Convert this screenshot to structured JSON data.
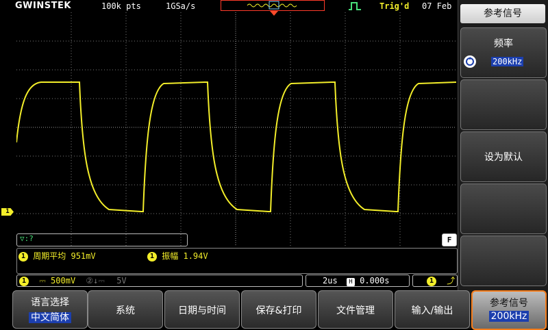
{
  "top_bar": {
    "brand": "GWINSTEK",
    "record_length": "100k pts",
    "sample_rate": "1GSa/s",
    "trigger_status": "Trig'd",
    "date": "07 Feb"
  },
  "channel_marker": "1",
  "hint": "▽:?",
  "f_indicator": "F",
  "measurements": {
    "m1_label": "周期平均",
    "m1_value": "951mV",
    "m2_label": "振幅",
    "m2_value": "1.94V"
  },
  "status": {
    "ch1_scale": "500mV",
    "ch2_scale": "5V",
    "timebase": "2us",
    "h_position": "0.000s"
  },
  "side_menu": {
    "title": "参考信号",
    "freq_label": "频率",
    "freq_value": "200kHz",
    "set_default": "设为默认"
  },
  "bottom_menu": {
    "language_label": "语言选择",
    "language_value": "中文简体",
    "system": "系统",
    "datetime": "日期与时间",
    "save_print": "保存&打印",
    "file_manager": "文件管理",
    "io": "输入/输出",
    "ref_signal_label": "参考信号",
    "ref_signal_value": "200kHz"
  },
  "colors": {
    "trace": "#f3ee2a",
    "accent_active": "#f57c1a",
    "highlight": "#1c3fae"
  },
  "waveform": {
    "type": "square-ish (RC edges)",
    "periods_visible": 3.5
  }
}
